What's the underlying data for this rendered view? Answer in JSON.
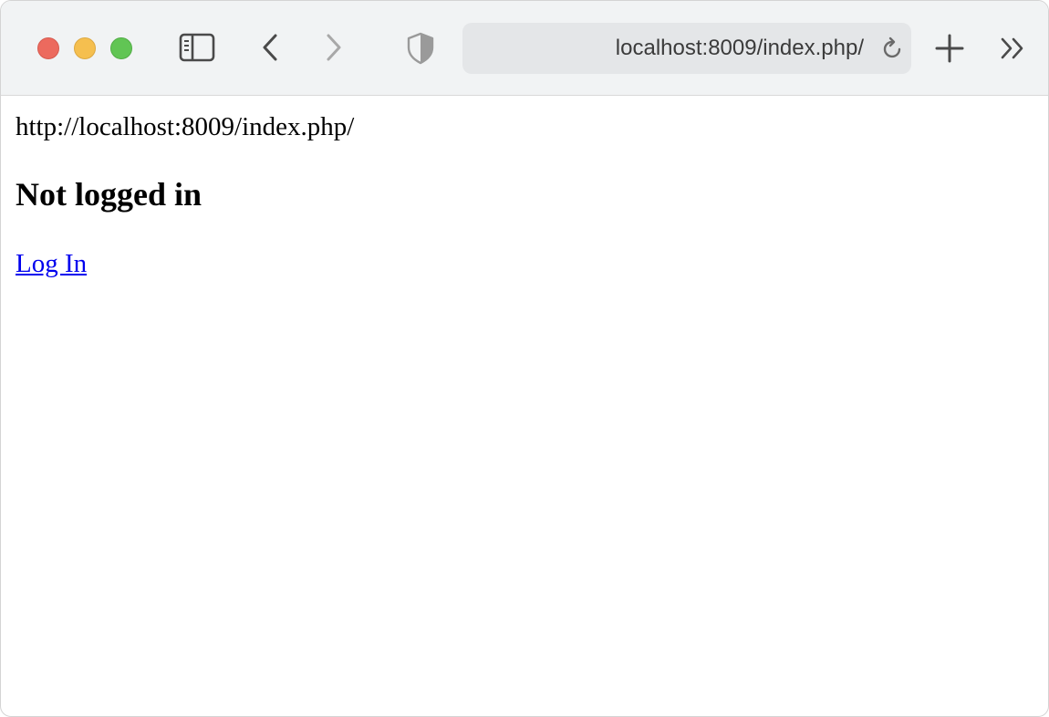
{
  "browser": {
    "address": "localhost:8009/index.php/",
    "icons": {
      "close": "close-dot",
      "minimize": "minimize-dot",
      "maximize": "maximize-dot",
      "sidebar": "sidebar-icon",
      "back": "chevron-left-icon",
      "forward": "chevron-right-icon",
      "privacy": "shield-icon",
      "reload": "reload-icon",
      "new_tab": "plus-icon",
      "overflow": "double-chevron-right-icon"
    },
    "colors": {
      "close": "#ec6a5e",
      "minimize": "#f5bf4f",
      "maximize": "#61c554",
      "toolbar": "#f1f3f4",
      "urlbar": "#e4e6e8"
    }
  },
  "page": {
    "url_text": "http://localhost:8009/index.php/",
    "heading": "Not logged in",
    "login_link": "Log In",
    "link_color": "#0000ee"
  }
}
